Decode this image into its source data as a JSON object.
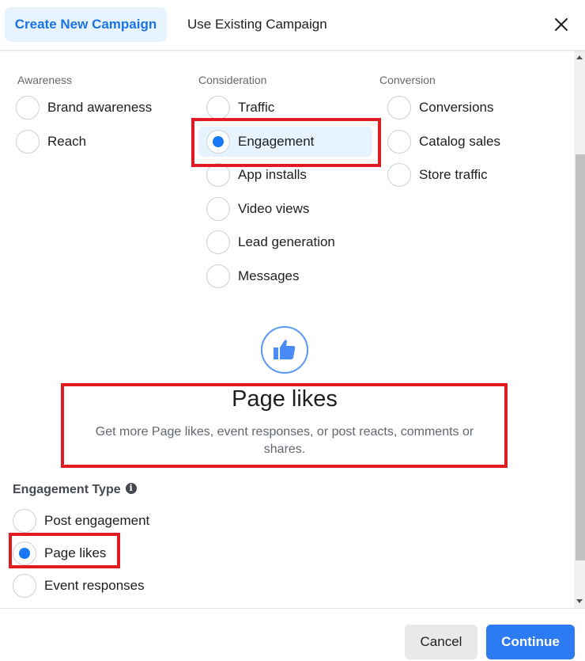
{
  "header": {
    "tabs": [
      {
        "label": "Create New Campaign",
        "active": true
      },
      {
        "label": "Use Existing Campaign",
        "active": false
      }
    ],
    "close_icon": "close-icon"
  },
  "objectives": {
    "columns": [
      {
        "title": "Awareness",
        "options": [
          {
            "label": "Brand awareness",
            "checked": false
          },
          {
            "label": "Reach",
            "checked": false
          }
        ]
      },
      {
        "title": "Consideration",
        "options": [
          {
            "label": "Traffic",
            "checked": false
          },
          {
            "label": "Engagement",
            "checked": true
          },
          {
            "label": "App installs",
            "checked": false
          },
          {
            "label": "Video views",
            "checked": false
          },
          {
            "label": "Lead generation",
            "checked": false
          },
          {
            "label": "Messages",
            "checked": false
          }
        ]
      },
      {
        "title": "Conversion",
        "options": [
          {
            "label": "Conversions",
            "checked": false
          },
          {
            "label": "Catalog sales",
            "checked": false
          },
          {
            "label": "Store traffic",
            "checked": false
          }
        ]
      }
    ]
  },
  "info": {
    "icon": "thumbs-up-icon",
    "title": "Page likes",
    "description": "Get more Page likes, event responses, or post reacts, comments or shares."
  },
  "engagement_type": {
    "title": "Engagement Type",
    "info_glyph": "i",
    "options": [
      {
        "label": "Post engagement",
        "checked": false
      },
      {
        "label": "Page likes",
        "checked": true
      },
      {
        "label": "Event responses",
        "checked": false
      }
    ]
  },
  "footer": {
    "cancel_label": "Cancel",
    "continue_label": "Continue"
  },
  "colors": {
    "accent": "#1877f2",
    "highlight": "#e21b23",
    "selected_bg": "#e7f3ff"
  }
}
